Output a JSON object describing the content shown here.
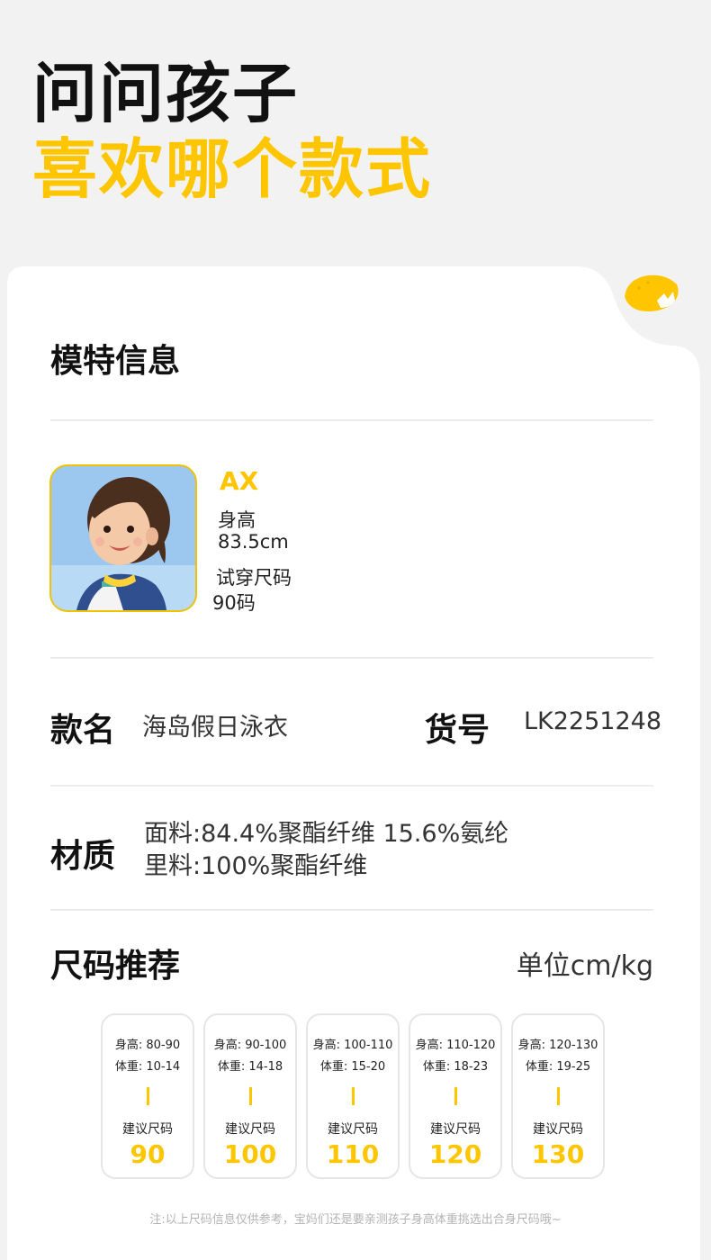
{
  "hero": {
    "line1": "问问孩子",
    "line2": "喜欢哪个款式"
  },
  "colors": {
    "accent": "#ffc600",
    "background": "#f2f2f2",
    "card": "#ffffff"
  },
  "model": {
    "title": "模特信息",
    "name": "AX",
    "height_label": "身高",
    "height_value": "83.5cm",
    "size_label": "试穿尺码",
    "size_value": "90码"
  },
  "product": {
    "name_label": "款名",
    "name_value": "海岛假日泳衣",
    "sku_label": "货号",
    "sku_value": "LK2251248"
  },
  "material": {
    "label": "材质",
    "line1": "面料:84.4%聚酯纤维 15.6%氨纶",
    "line2": "里料:100%聚酯纤维"
  },
  "sizes": {
    "title": "尺码推荐",
    "unit": "单位cm/kg",
    "suggest_label": "建议尺码",
    "items": [
      {
        "height": "身高:   80-90",
        "weight": "体重: 10-14",
        "size": "90"
      },
      {
        "height": "身高:  90-100",
        "weight": "体重: 14-18",
        "size": "100"
      },
      {
        "height": "身高: 100-110",
        "weight": "体重: 15-20",
        "size": "110"
      },
      {
        "height": "身高: 110-120",
        "weight": "体重: 18-23",
        "size": "120"
      },
      {
        "height": "身高: 120-130",
        "weight": "体重: 19-25",
        "size": "130"
      }
    ]
  },
  "note": "注:以上尺码信息仅供参考，宝妈们还是要亲测孩子身高体重挑选出合身尺码哦~"
}
